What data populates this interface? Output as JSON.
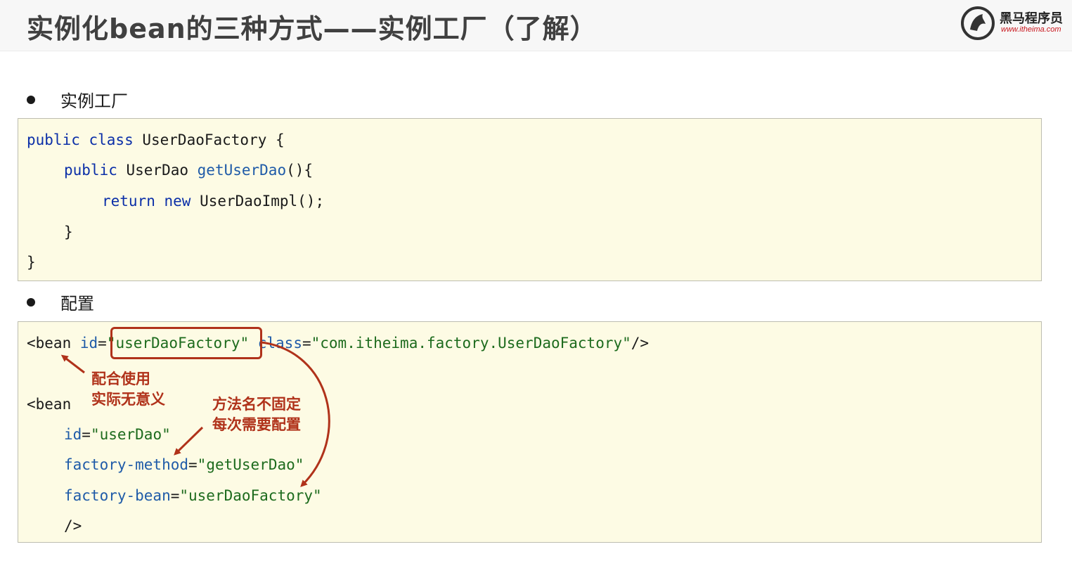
{
  "header": {
    "title": "实例化bean的三种方式——实例工厂（了解）",
    "logo_cn": "黑马程序员",
    "logo_url": "www.itheima.com"
  },
  "sections": {
    "instance_factory_label": "实例工厂",
    "config_label": "配置"
  },
  "java_code": {
    "line1": {
      "kw": "public class",
      "rest": " UserDaoFactory {"
    },
    "line2": {
      "kw": "public",
      "type": " UserDao ",
      "fn": "getUserDao",
      "rest": "(){"
    },
    "line3": {
      "kw": "return new",
      "rest": " UserDaoImpl();"
    },
    "line4": "}",
    "line5": "}"
  },
  "xml_code": {
    "bean1": {
      "open": "<bean ",
      "id_attr": "id",
      "id_eq": "=",
      "id_val": "\"userDaoFactory\"",
      "class_attr": " class",
      "class_eq": "=",
      "class_val": "\"com.itheima.factory.UserDaoFactory\"",
      "close": "/>"
    },
    "bean2_open": "<bean",
    "id_attr": "id",
    "id_eq": "=",
    "id_val": "\"userDao\"",
    "fm_attr": "factory-method",
    "fm_eq": "=",
    "fm_val": "\"getUserDao\"",
    "fb_attr": "factory-bean",
    "fb_eq": "=",
    "fb_val": "\"userDaoFactory\"",
    "close": "/>"
  },
  "annotations": {
    "note1_line1": "配合使用",
    "note1_line2": "实际无意义",
    "note2_line1": "方法名不固定",
    "note2_line2": "每次需要配置"
  },
  "colors": {
    "annotation": "#b0321a",
    "keyword": "#0b2fa8",
    "string": "#1d6b1d",
    "code_bg": "#fdfbe4"
  }
}
